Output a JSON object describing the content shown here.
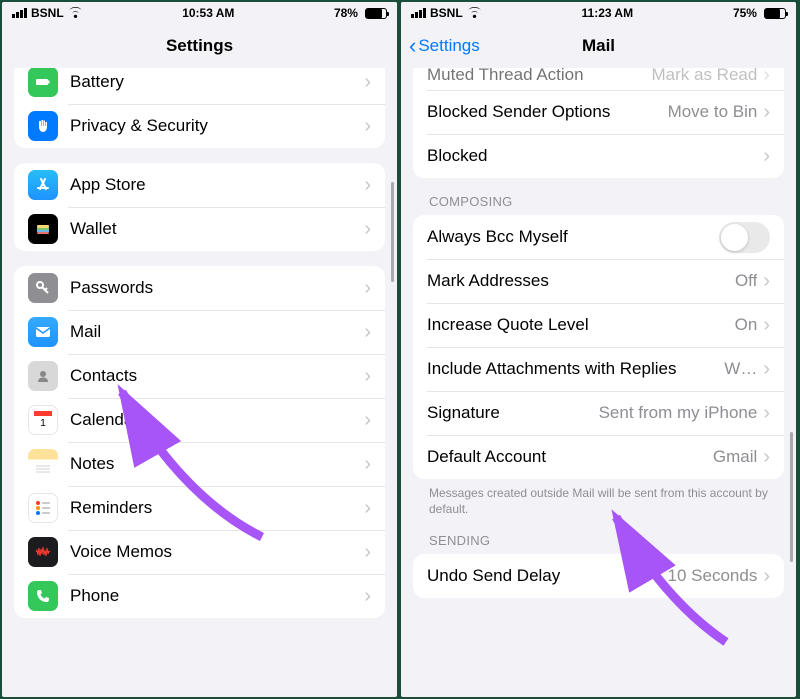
{
  "left": {
    "status": {
      "carrier": "BSNL",
      "time": "10:53 AM",
      "battery_pct": "78%",
      "battery_fill": 78
    },
    "nav": {
      "title": "Settings"
    },
    "sections": [
      {
        "rows": [
          {
            "icon": "battery-icon",
            "bg": "#34c759",
            "label": "Battery"
          },
          {
            "icon": "hand-icon",
            "bg": "#007aff",
            "label": "Privacy & Security"
          }
        ]
      },
      {
        "rows": [
          {
            "icon": "appstore-icon",
            "bg": "#1f93ff",
            "label": "App Store"
          },
          {
            "icon": "wallet-icon",
            "bg": "#000",
            "label": "Wallet"
          }
        ]
      },
      {
        "rows": [
          {
            "icon": "key-icon",
            "bg": "#8e8e93",
            "label": "Passwords"
          },
          {
            "icon": "mail-icon",
            "bg": "#1f93ff",
            "label": "Mail"
          },
          {
            "icon": "contacts-icon",
            "bg": "#c7c7cc",
            "label": "Contacts"
          },
          {
            "icon": "calendar-icon",
            "bg": "#fff",
            "label": "Calendar"
          },
          {
            "icon": "notes-icon",
            "bg": "#fff",
            "label": "Notes"
          },
          {
            "icon": "reminders-icon",
            "bg": "#fff",
            "label": "Reminders"
          },
          {
            "icon": "voicememo-icon",
            "bg": "#1c1c1e",
            "label": "Voice Memos"
          },
          {
            "icon": "phone-icon",
            "bg": "#34c759",
            "label": "Phone"
          }
        ]
      }
    ]
  },
  "right": {
    "status": {
      "carrier": "BSNL",
      "time": "11:23 AM",
      "battery_pct": "75%",
      "battery_fill": 75
    },
    "nav": {
      "back": "Settings",
      "title": "Mail"
    },
    "top_section": {
      "rows": [
        {
          "label": "Muted Thread Action",
          "value": "Mark as Read",
          "faded": true
        },
        {
          "label": "Blocked Sender Options",
          "value": "Move to Bin"
        },
        {
          "label": "Blocked",
          "value": ""
        }
      ]
    },
    "composing": {
      "header": "COMPOSING",
      "rows": [
        {
          "label": "Always Bcc Myself",
          "type": "toggle",
          "on": false
        },
        {
          "label": "Mark Addresses",
          "value": "Off"
        },
        {
          "label": "Increase Quote Level",
          "value": "On"
        },
        {
          "label": "Include Attachments with Replies",
          "value": "W…"
        },
        {
          "label": "Signature",
          "value": "Sent from my iPhone"
        },
        {
          "label": "Default Account",
          "value": "Gmail"
        }
      ],
      "footer": "Messages created outside Mail will be sent from this account by default."
    },
    "sending": {
      "header": "SENDING",
      "rows": [
        {
          "label": "Undo Send Delay",
          "value": "10 Seconds"
        }
      ]
    }
  }
}
